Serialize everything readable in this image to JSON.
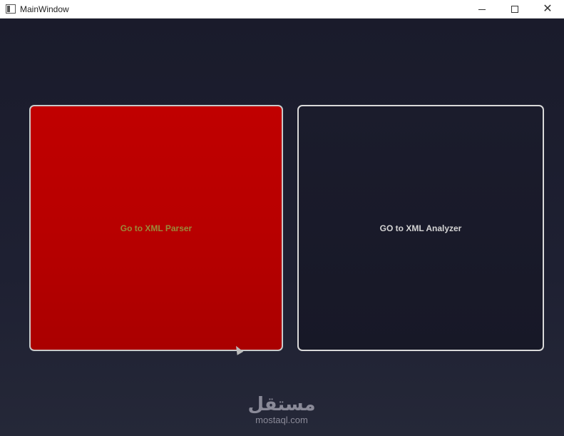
{
  "window": {
    "title": "MainWindow",
    "controls": {
      "minimize": "minimize-icon",
      "maximize": "maximize-icon",
      "close": "close-icon"
    }
  },
  "main": {
    "parser_button_label": "Go to XML Parser",
    "analyzer_button_label": "GO to XML Analyzer"
  },
  "watermark": {
    "arabic": "مستقل",
    "latin": "mostaql.com"
  },
  "colors": {
    "parser_button": "#c00000",
    "background": "#1c1e2e",
    "border": "#d9d9d9"
  }
}
